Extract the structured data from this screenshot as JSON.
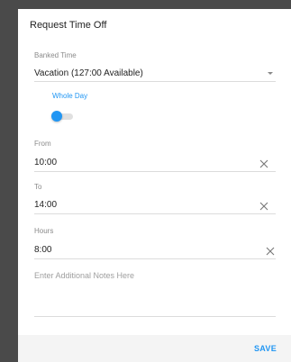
{
  "dialog": {
    "title": "Request Time Off"
  },
  "banked_time": {
    "label": "Banked Time",
    "value": "Vacation (127:00 Available)",
    "icon": "dropdown-caret-icon"
  },
  "whole_day": {
    "label": "Whole Day",
    "enabled": false,
    "accent_color": "#2196f3"
  },
  "from": {
    "label": "From",
    "value": "10:00",
    "clear_icon": "close-icon"
  },
  "to": {
    "label": "To",
    "value": "14:00",
    "clear_icon": "close-icon"
  },
  "hours": {
    "label": "Hours",
    "value": "8:00",
    "clear_icon": "close-icon"
  },
  "notes": {
    "placeholder": "Enter Additional Notes Here"
  },
  "footer": {
    "save_label": "SAVE"
  }
}
